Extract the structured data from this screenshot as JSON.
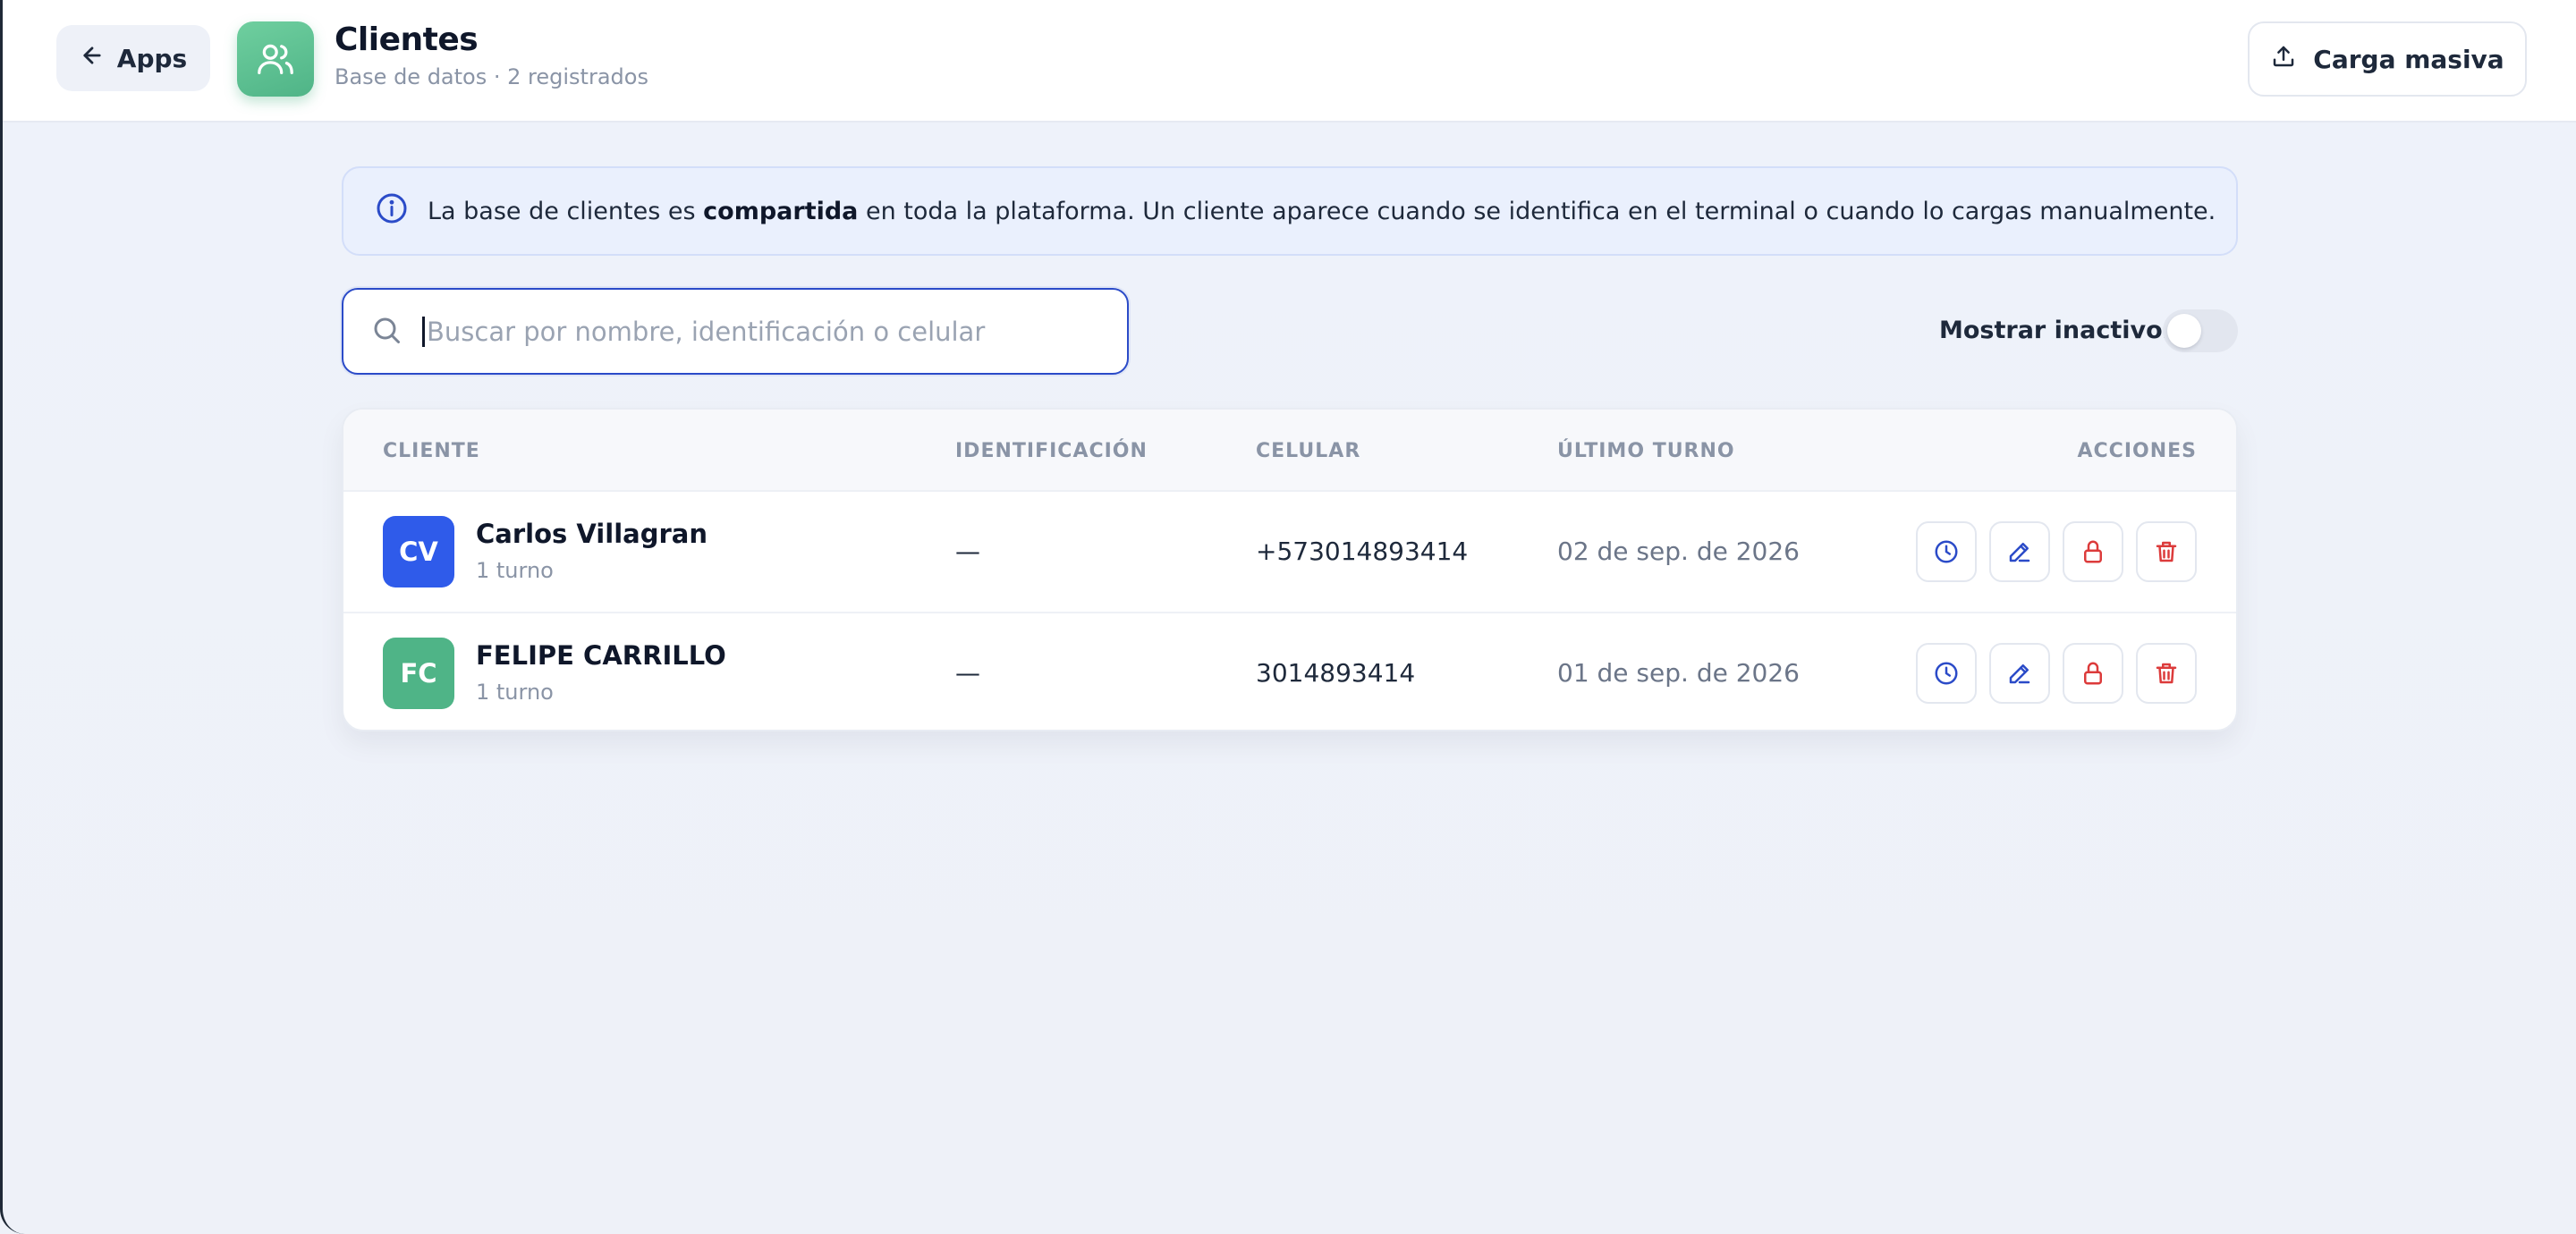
{
  "header": {
    "back_label": "Apps",
    "title": "Clientes",
    "subtitle": "Base de datos · 2 registrados",
    "bulk_upload_label": "Carga masiva",
    "app_icon": "users-icon"
  },
  "info_banner": {
    "text_before": "La base de clientes es ",
    "text_bold": "compartida",
    "text_after": " en toda la plataforma. Un cliente aparece cuando se identifica en el terminal o cuando lo cargas manualmente."
  },
  "search": {
    "placeholder": "Buscar por nombre, identificación o celular",
    "value": ""
  },
  "inactive_toggle": {
    "label": "Mostrar inactivos",
    "on": false
  },
  "table": {
    "columns": {
      "client": "CLIENTE",
      "id": "IDENTIFICACIÓN",
      "phone": "CELULAR",
      "last_turn": "ÚLTIMO TURNO",
      "actions": "ACCIONES"
    },
    "rows": [
      {
        "initials": "CV",
        "name": "Carlos Villagran",
        "turns": "1 turno",
        "identification": "—",
        "phone": "+573014893414",
        "last_turn": "02 de sep. de 2026"
      },
      {
        "initials": "FC",
        "name": "FELIPE CARRILLO",
        "turns": "1 turno",
        "identification": "—",
        "phone": "3014893414",
        "last_turn": "01 de sep. de 2026"
      }
    ],
    "row_actions": [
      "history-clock-icon",
      "edit-pencil-icon",
      "lock-icon",
      "trash-icon"
    ]
  },
  "colors": {
    "accent_blue": "#2b4bc8",
    "avatar_blue": "#2f5bea",
    "avatar_green": "#4fb487",
    "danger_red": "#dc3b3b",
    "app_icon_green": "#5fc294"
  }
}
